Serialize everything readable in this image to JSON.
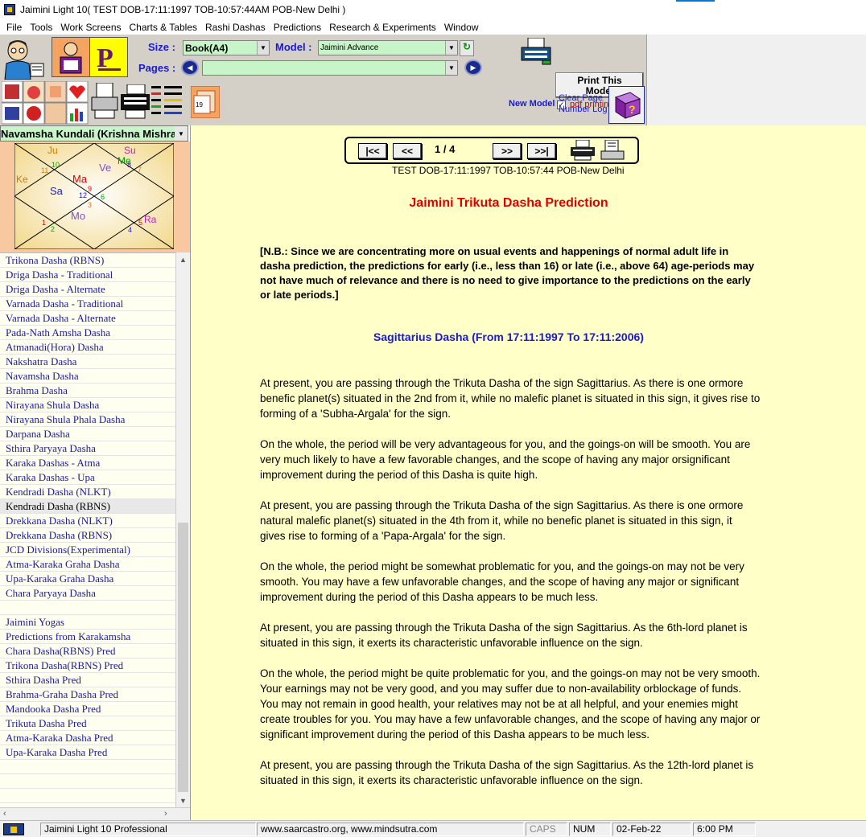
{
  "window": {
    "title": "Jaimini Light 10( TEST DOB-17:11:1997 TOB-10:57:44AM POB-New Delhi )"
  },
  "menu": [
    "File",
    "Tools",
    "Work Screens",
    "Charts & Tables",
    "Rashi Dashas",
    "Predictions",
    "Research & Experiments",
    "Window"
  ],
  "toolbar": {
    "size_label": "Size :",
    "size_value": "Book(A4)",
    "model_label": "Model :",
    "model_value": "Jaimini Advance",
    "pages_label": "Pages :",
    "pages_value": "",
    "new_model": "New Model",
    "print_model_line1": "Print This",
    "print_model_line2": "Model",
    "pdf_mode": "pdf printing mode",
    "pdf_checked": "✓",
    "clear_page_line1": "Clear Page",
    "clear_page_line2": "Number Log"
  },
  "left": {
    "chart_select": "Navamsha Kundali (Krishna Mishra)",
    "kundali": {
      "planets": [
        {
          "name": "Ju",
          "color": "#d27a00"
        },
        {
          "name": "Su",
          "color": "#c020c0"
        },
        {
          "name": "Me",
          "color": "#00a000"
        },
        {
          "name": "Ve",
          "color": "#8050c0"
        },
        {
          "name": "Ke",
          "color": "#d27a00"
        },
        {
          "name": "Ma",
          "color": "#e00000"
        },
        {
          "name": "Sa",
          "color": "#1a1ad0"
        },
        {
          "name": "Mo",
          "color": "#8050c0"
        },
        {
          "name": "Ra",
          "color": "#c020c0"
        }
      ],
      "signs": [
        "10",
        "8",
        "7",
        "11",
        "9",
        "12",
        "3",
        "6",
        "1",
        "2",
        "5",
        "4"
      ]
    },
    "dasha_list": [
      "Trikona Dasha (RBNS)",
      "Driga Dasha - Traditional",
      "Driga Dasha - Alternate",
      "Varnada Dasha - Traditional",
      "Varnada Dasha - Alternate",
      "Pada-Nath Amsha Dasha",
      "Atmanadi(Hora) Dasha",
      "Nakshatra Dasha",
      "Navamsha Dasha",
      "Brahma Dasha",
      "Nirayana Shula Dasha",
      "Nirayana Shula Phala Dasha",
      "Darpana Dasha",
      "Sthira Paryaya Dasha",
      "Karaka Dashas - Atma",
      "Karaka Dashas - Upa",
      "Kendradi  Dasha (NLKT)",
      "Kendradi  Dasha (RBNS)",
      "Drekkana Dasha (NLKT)",
      "Drekkana Dasha (RBNS)",
      "JCD Divisions(Experimental)",
      "Atma-Karaka Graha Dasha",
      "Upa-Karaka Graha Dasha",
      "Chara Paryaya Dasha",
      "",
      "Jaimini Yogas",
      "Predictions from Karakamsha",
      "Chara Dasha(RBNS) Pred",
      "Trikona Dasha(RBNS) Pred",
      "Sthira Dasha Pred",
      "Brahma-Graha Dasha Pred",
      "Mandooka Dasha Pred",
      "Trikuta Dasha Pred",
      "Atma-Karaka Dasha Pred",
      "Upa-Karaka Dasha Pred",
      "",
      "",
      ""
    ],
    "selected_index": 17
  },
  "main": {
    "nav": {
      "first": "|<<",
      "prev": "<<",
      "page": "1 / 4",
      "next": ">>",
      "last": ">>|"
    },
    "sub_info": "TEST DOB-17:11:1997 TOB-10:57:44 POB-New Delhi",
    "title": "Jaimini Trikuta Dasha Prediction",
    "note": "[N.B.: Since we are concentrating more on usual events and happenings of normal adult life in dasha prediction, the predictions for early (i.e., less than 16) or late (i.e., above 64) age-periods may not have much of relevance and there is no need to give importance to the predictions on the early or late periods.]",
    "dasha_heading": "Sagittarius Dasha (From 17:11:1997 To 17:11:2006)",
    "paragraphs": [
      "At present, you are passing through the Trikuta Dasha of the sign Sagittarius. As there is one ormore benefic planet(s) situated in the 2nd from it, while no malefic planet is situated in this sign, it gives rise to forming of a 'Subha-Argala' for the sign.",
      "On the whole, the period will be very advantageous for you, and the goings-on will be smooth. You are very much likely to have a few favorable changes, and the scope of having any major orsignificant improvement during the period of this Dasha is quite high.",
      "At present, you are passing through the Trikuta Dasha of the sign Sagittarius. As there is one ormore natural malefic planet(s) situated in the 4th from it, while no benefic planet is situated in this sign, it gives rise to forming of a 'Papa-Argala' for the sign.",
      "On the whole, the period might be somewhat problematic for you, and the goings-on may not be very smooth. You may have a few unfavorable changes, and the scope of having any major or significant improvement during the period of this Dasha appears to be much less.",
      "At present, you are passing through the Trikuta Dasha of the sign Sagittarius. As the 6th-lord planet is situated in this sign, it exerts its characteristic unfavorable influence on the sign.",
      "On the whole, the period might be quite problematic for you, and the goings-on may not be very smooth. Your earnings may not be very good, and you may suffer due to non-availability orblockage of funds. You may not remain in good health, your relatives may not be at all helpful, and your enemies might create troubles for you. You may have a few unfavorable changes, and the scope of having any major or significant improvement during the period of this Dasha appears to be much less.",
      "At present, you are passing through the Trikuta Dasha of the sign Sagittarius. As the 12th-lord planet is situated in this sign, it exerts its characteristic unfavorable influence on the sign."
    ]
  },
  "status": {
    "app": "Jaimini Light 10 Professional",
    "website": "www.saarcastro.org, www.mindsutra.com",
    "caps": "CAPS",
    "num": "NUM",
    "date": "02-Feb-22",
    "time": "6:00 PM"
  }
}
